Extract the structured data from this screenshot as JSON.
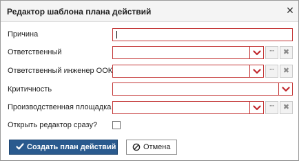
{
  "dialog": {
    "title": "Редактор шаблона плана действий",
    "close_icon": "close-icon"
  },
  "form": {
    "fields": [
      {
        "label": "Причина",
        "type": "text",
        "value": ""
      },
      {
        "label": "Ответственный",
        "type": "select-lookup",
        "value": ""
      },
      {
        "label": "Ответственный инженер ООК",
        "type": "select-lookup",
        "value": ""
      },
      {
        "label": "Критичность",
        "type": "select",
        "value": ""
      },
      {
        "label": "Производственная площадка",
        "type": "select-lookup",
        "value": ""
      }
    ],
    "open_editor": {
      "label": "Открыть редактор сразу?",
      "checked": false
    }
  },
  "buttons": {
    "create_label": "Создать план действий",
    "cancel_label": "Отмена"
  },
  "colors": {
    "accent": "#2a5a8e",
    "invalid_border": "#c33434",
    "dropdown_chevron": "#c0262c"
  },
  "icons": {
    "dropdown": "chevron-down-icon",
    "lookup": "ellipsis-icon",
    "clear": "clear-x-icon",
    "create": "checkmark-icon",
    "cancel": "cancel-circle-icon"
  }
}
